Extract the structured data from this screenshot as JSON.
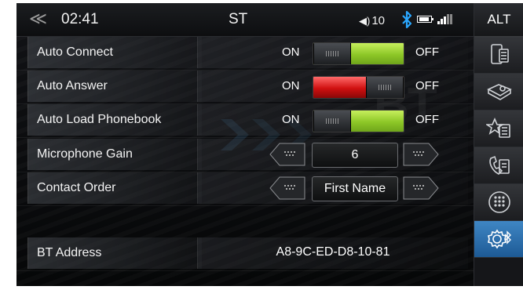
{
  "status_bar": {
    "back_label": "≪",
    "time": "02:41",
    "source": "ST",
    "volume_label": "10"
  },
  "sidebar": {
    "alt_label": "ALT",
    "active_index": 5,
    "items": [
      {
        "name": "phone-device-icon"
      },
      {
        "name": "contacts-book-icon"
      },
      {
        "name": "favorites-list-icon"
      },
      {
        "name": "call-history-icon"
      },
      {
        "name": "dialpad-icon"
      },
      {
        "name": "bluetooth-settings-icon"
      }
    ]
  },
  "watermark": "BT",
  "settings": {
    "auto_connect": {
      "label": "Auto Connect",
      "on_label": "ON",
      "off_label": "OFF",
      "state": "ON"
    },
    "auto_answer": {
      "label": "Auto Answer",
      "on_label": "ON",
      "off_label": "OFF",
      "state": "OFF"
    },
    "auto_load_phonebook": {
      "label": "Auto Load Phonebook",
      "on_label": "ON",
      "off_label": "OFF",
      "state": "ON"
    },
    "microphone_gain": {
      "label": "Microphone Gain",
      "value": "6"
    },
    "contact_order": {
      "label": "Contact Order",
      "value": "First Name"
    },
    "bt_address": {
      "label": "BT Address",
      "value": "A8-9C-ED-D8-10-81"
    }
  },
  "colors": {
    "toggle_on": "#8dc727",
    "toggle_off": "#d01010",
    "active_tab": "#2f77b8",
    "bluetooth": "#2aa7ff"
  }
}
